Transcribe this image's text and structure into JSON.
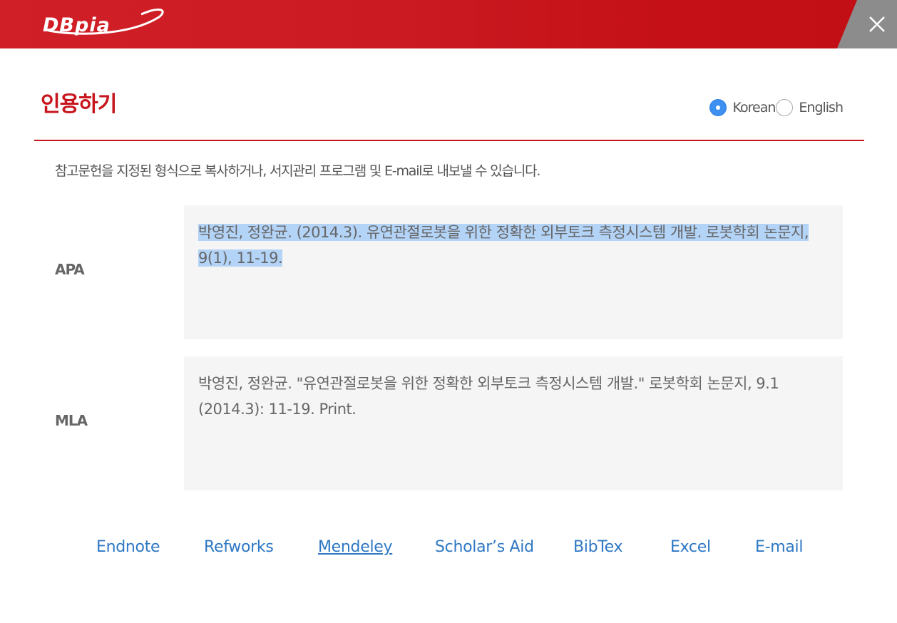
{
  "header": {
    "logo_text": "DBpia",
    "close_label": "close"
  },
  "title": "인용하기",
  "language": {
    "options": [
      {
        "label": "Korean",
        "selected": true
      },
      {
        "label": "English",
        "selected": false
      }
    ]
  },
  "description": "참고문헌을 지정된 형식으로 복사하거나, 서지관리 프로그램 및 E-mail로 내보낼 수 있습니다.",
  "citations": [
    {
      "label": "APA",
      "text": "박영진, 정완균. (2014.3). 유연관절로봇을 위한 정확한 외부토크 측정시스템 개발. 로봇학회 논문지, 9(1), 11-19.",
      "selected": true
    },
    {
      "label": "MLA",
      "text": "박영진, 정완균. \"유연관절로봇을 위한 정확한 외부토크 측정시스템 개발.\" 로봇학회 논문지, 9.1 (2014.3): 11-19. Print.",
      "selected": false
    }
  ],
  "export_links": [
    {
      "label": "Endnote"
    },
    {
      "label": "Refworks"
    },
    {
      "label": "Mendeley",
      "underlined": true
    },
    {
      "label": "Scholar’s Aid"
    },
    {
      "label": "BibTex"
    },
    {
      "label": "Excel"
    },
    {
      "label": "E-mail"
    }
  ],
  "colors": {
    "brand_red": "#c8161e",
    "link_blue": "#2e78c4",
    "radio_blue": "#3d8ff0",
    "selection": "#b3d3f7"
  }
}
